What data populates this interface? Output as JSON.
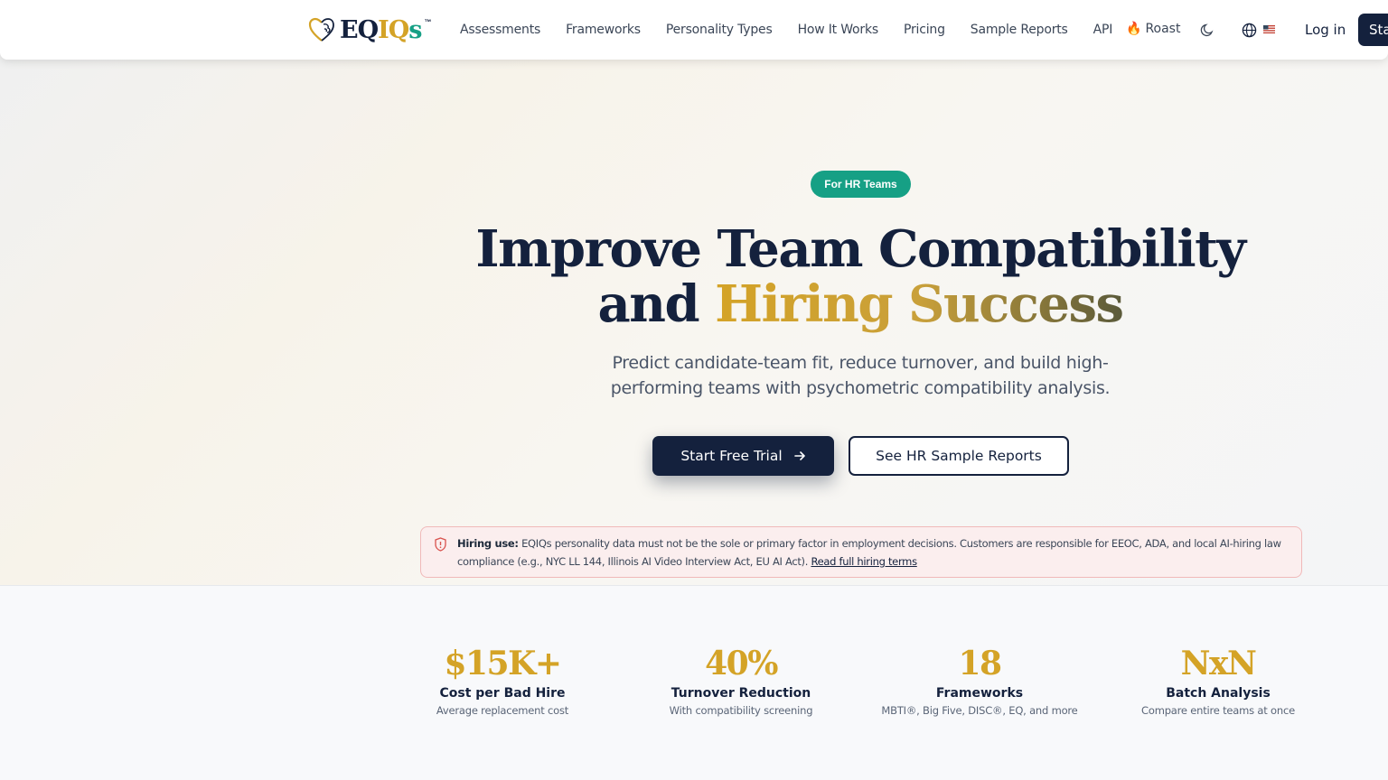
{
  "nav": {
    "logo": {
      "eq": "EQ",
      "iq": "IQ",
      "s": "s",
      "tm": "™"
    },
    "links": [
      "Assessments",
      "Frameworks",
      "Personality Types",
      "How It Works",
      "Pricing",
      "Sample Reports",
      "API"
    ],
    "roast": "Roast",
    "login": "Log in",
    "start": "Sta"
  },
  "hero": {
    "badge": "For HR Teams",
    "headline_line1": "Improve Team Compatibility",
    "headline_and": "and",
    "headline_gold": "Hiring Success",
    "subheadline": "Predict candidate-team fit, reduce turnover, and build high-performing teams with psychometric compatibility analysis.",
    "primary_cta": "Start Free Trial",
    "secondary_cta": "See HR Sample Reports"
  },
  "notice": {
    "label": "Hiring use:",
    "text": "EQIQs personality data must not be the sole or primary factor in employment decisions. Customers are responsible for EEOC, ADA, and local AI-hiring law compliance (e.g., NYC LL 144, Illinois AI Video Interview Act, EU AI Act).",
    "link": "Read full hiring terms"
  },
  "stats": [
    {
      "value": "$15K+",
      "label": "Cost per Bad Hire",
      "desc": "Average replacement cost"
    },
    {
      "value": "40%",
      "label": "Turnover Reduction",
      "desc": "With compatibility screening"
    },
    {
      "value": "18",
      "label": "Frameworks",
      "desc": "MBTI®, Big Five, DISC®, EQ, and more"
    },
    {
      "value": "NxN",
      "label": "Batch Analysis",
      "desc": "Compare entire teams at once"
    }
  ],
  "colors": {
    "navy": "#14213d",
    "gold": "#d4a327",
    "teal": "#16a085",
    "notice_bg": "#fbeeee"
  },
  "icons": [
    "brain-heart-logo-icon",
    "fire-icon",
    "moon-icon",
    "globe-icon",
    "us-flag-icon",
    "arrow-right-icon",
    "shield-alert-icon"
  ]
}
